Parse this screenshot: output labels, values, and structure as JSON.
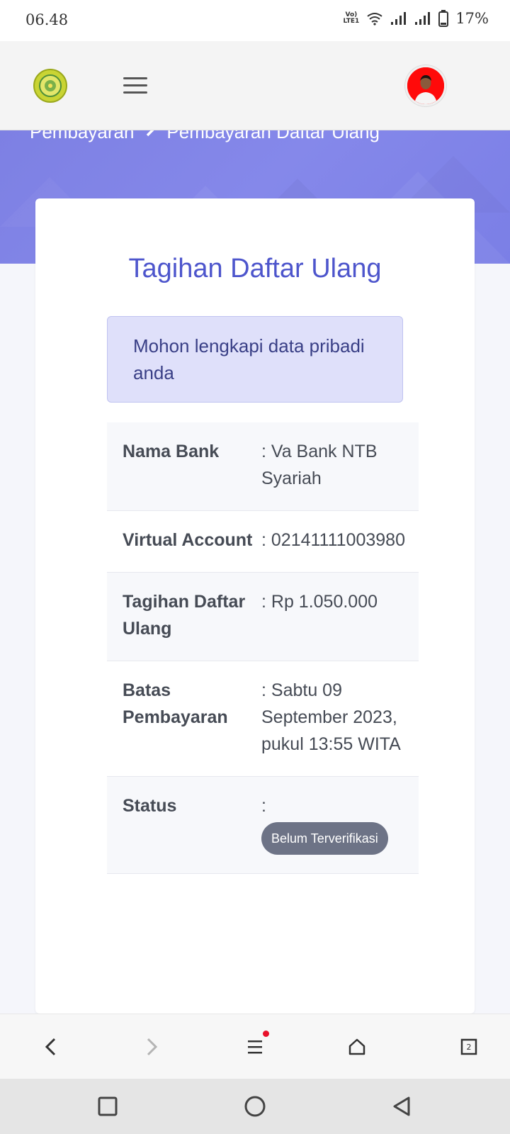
{
  "status_bar": {
    "time": "06.48",
    "volte_line1": "Vo)",
    "volte_line2": "LTE1",
    "battery_percent": "17%"
  },
  "header": {
    "logo_icon": "university-seal-icon",
    "menu_icon": "hamburger-menu-icon",
    "avatar_icon": "user-avatar-icon"
  },
  "breadcrumb": {
    "items": [
      "Pembayaran",
      "Pembayaran Daftar Ulang"
    ],
    "separator_icon": "chevron-right-icon"
  },
  "card": {
    "title": "Tagihan Daftar Ulang",
    "alert": "Mohon lengkapi data pribadi anda",
    "rows": [
      {
        "label": "Nama Bank",
        "value": ": Va Bank NTB Syariah"
      },
      {
        "label": "Virtual Account",
        "value": ": 02141111003980"
      },
      {
        "label": "Tagihan Daftar Ulang",
        "value": ": Rp 1.050.000"
      },
      {
        "label": "Batas Pembayaran",
        "value": ": Sabtu 09 September 2023, pukul 13:55 WITA"
      },
      {
        "label": "Status",
        "value": ":",
        "badge": "Belum Terverifikasi"
      }
    ]
  },
  "browser_bar": {
    "tab_count": "2",
    "icons": [
      "back-arrow-icon",
      "forward-arrow-icon",
      "menu-icon",
      "home-icon",
      "tabs-icon"
    ]
  },
  "nav_bar": {
    "icons": [
      "recents-square-icon",
      "home-circle-icon",
      "back-triangle-icon"
    ]
  },
  "colors": {
    "accent": "#4d55cc",
    "banner": "#7d80e3",
    "alert_bg": "#dfe0fa",
    "badge_bg": "#6d7386",
    "notification_dot": "#e8102a"
  }
}
